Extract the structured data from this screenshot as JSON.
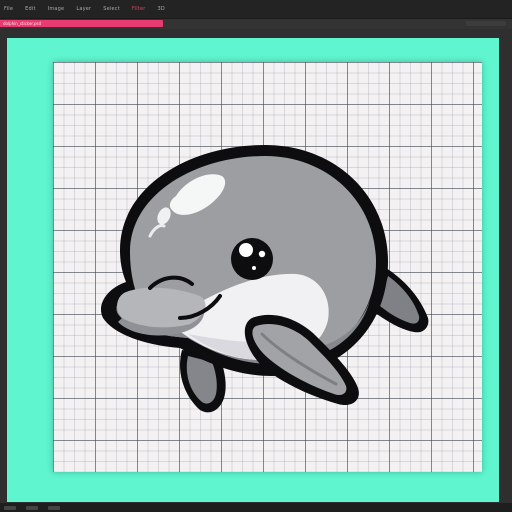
{
  "menu": {
    "items": [
      "File",
      "Edit",
      "Image",
      "Layer",
      "Select",
      "Filter",
      "3D"
    ],
    "accent_item_index": 5
  },
  "document_tab": {
    "label": "dolphin_sticker.psd"
  },
  "colors": {
    "canvas_background": "#5ef5cf",
    "document_tab": "#e83b71",
    "dolphin_body": "#9c9ea2",
    "dolphin_belly": "#f1f1f4",
    "outline": "#0d0d0f"
  },
  "artwork": {
    "subject": "dolphin-sticker"
  }
}
